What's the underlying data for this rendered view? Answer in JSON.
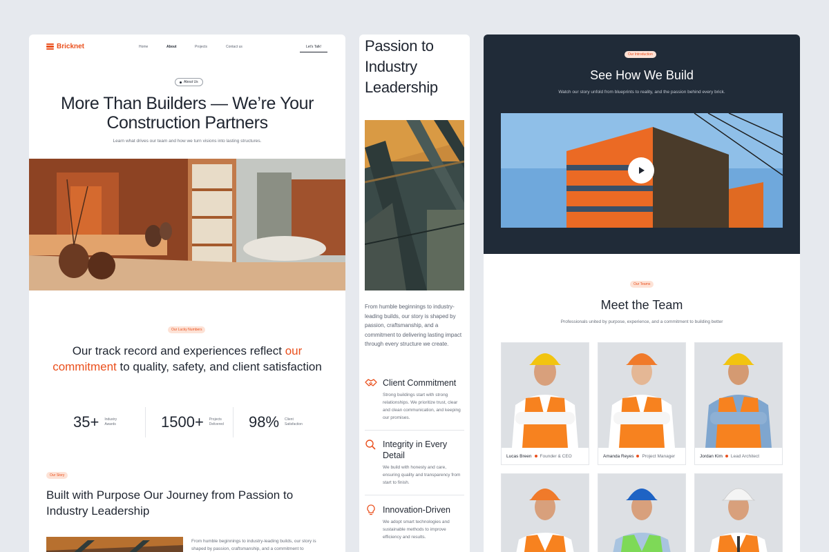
{
  "colors": {
    "accent": "#ea4f1c",
    "dark": "#202b38",
    "background": "#e6e9ee"
  },
  "brand": {
    "name": "Bricknet",
    "icon": "bricks-logo-icon"
  },
  "nav": {
    "links": [
      "Home",
      "About",
      "Projects",
      "Contact us"
    ],
    "active": "About",
    "cta": "Let's Talk!"
  },
  "hero": {
    "badge": "About Us",
    "title_line1": "More Than Builders — We’re Your",
    "title_line2": "Construction Partners",
    "subtitle": "Learn what drives our team and how we turn visions into lasting structures."
  },
  "numbers": {
    "badge": "Our Lucky Numbers",
    "title_part1": "Our track record and experiences reflect ",
    "title_accent": "our commitment",
    "title_part2": " to quality, safety, and client satisfaction",
    "stats": [
      {
        "value": "35+",
        "label": "Industry Awards"
      },
      {
        "value": "1500+",
        "label": "Projects Delivered"
      },
      {
        "value": "98%",
        "label": "Client Satisfaction"
      }
    ]
  },
  "story": {
    "badge": "Our Story",
    "title": "Built with Purpose Our Journey from Passion to Industry Leadership",
    "text": "From humble beginnings to industry-leading builds, our story is shaped by passion, craftsmanship, and a commitment to",
    "mid_title": "Passion to Industry Leadership",
    "mid_text": "From humble beginnings to industry-leading builds, our story is shaped by passion, craftsmanship, and a commitment to delivering lasting impact through every structure we create."
  },
  "features": [
    {
      "icon": "handshake-icon",
      "title": "Client Commitment",
      "desc": "Strong buildings start with strong relationships. We prioritize trust, clear and clean communication, and keeping our promises."
    },
    {
      "icon": "search-icon",
      "title": "Integrity in Every Detail",
      "desc": "We build with honesty and care, ensuring quality and transparency from start to finish."
    },
    {
      "icon": "lightbulb-icon",
      "title": "Innovation-Driven",
      "desc": "We adopt smart technologies and sustainable methods to improve efficiency and results."
    }
  ],
  "intro": {
    "badge": "Our Introduction",
    "title": "See How We Build",
    "subtitle": "Watch our story unfold from blueprints to reality, and the passion behind every brick.",
    "play_icon": "play-icon"
  },
  "team": {
    "badge": "Our Teams",
    "title": "Meet the Team",
    "subtitle": "Professionals united by purpose, experience, and a commitment to building better",
    "members": [
      {
        "name": "Lucas Breen",
        "role": "Founder & CEO",
        "helmet": "#f2c40f",
        "vest": "#f7821f"
      },
      {
        "name": "Amanda Reyes",
        "role": "Project Manager",
        "helmet": "#f07a2a",
        "vest": "#f7821f"
      },
      {
        "name": "Jordan Kim",
        "role": "Lead Architect",
        "helmet": "#f2c40f",
        "vest": "#f7821f"
      }
    ],
    "more_members": [
      {
        "helmet": "#f07a2a",
        "vest": "#f7821f"
      },
      {
        "helmet": "#1e63c4",
        "vest": "#7ed957"
      },
      {
        "helmet": "#f4f4f4",
        "vest": "#f7821f"
      }
    ]
  }
}
